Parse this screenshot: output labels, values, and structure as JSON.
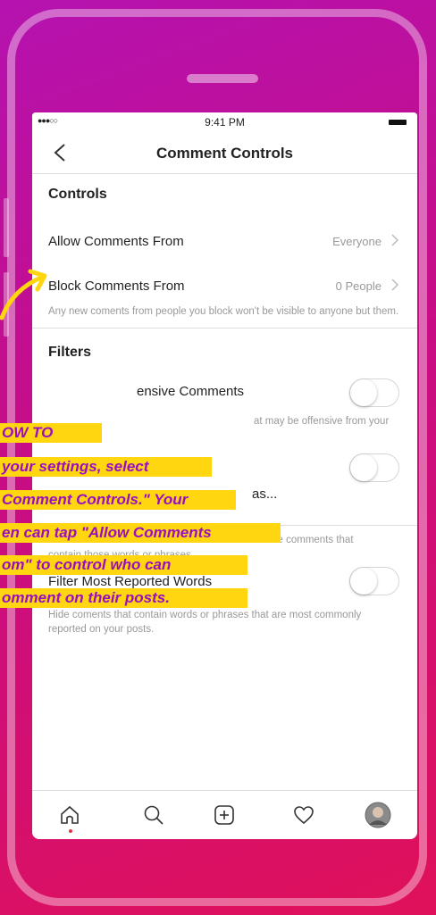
{
  "status_bar": {
    "time": "9:41 PM",
    "signal": "●●●○○"
  },
  "nav": {
    "title": "Comment Controls"
  },
  "controls": {
    "heading": "Controls",
    "allow_label": "Allow Comments From",
    "allow_value": "Everyone",
    "block_label": "Block Comments From",
    "block_value": "0 People",
    "block_desc": "Any new coments from people you block won't be visible to anyone but them."
  },
  "filters": {
    "heading": "Filters",
    "offensive_label_visible": "ensive Comments",
    "offensive_desc_visible": "at may be offensive from your",
    "manual_label_visible": "as...",
    "manual_desc_visible": "will hide comments that",
    "manual_desc_line2": "contain those words or phrases.",
    "reported_label": "Filter Most Reported Words",
    "reported_desc": "Hide coments that contain words or phrases that are most commonly reported on your posts.",
    "offensive_toggle_on": false,
    "manual_toggle_on": false,
    "reported_toggle_on": false
  },
  "overlay": {
    "lines": [
      "OW TO",
      "your settings, select",
      "Comment Controls.\" Your",
      "en can tap \"Allow Comments",
      "om\" to control who can",
      "omment on their posts."
    ],
    "highlight_color": "#ffd60f",
    "text_color": "#9a0dc3"
  },
  "tab_bar": {
    "icons": [
      "home-icon",
      "search-icon",
      "add-post-icon",
      "activity-heart-icon",
      "profile-avatar"
    ]
  },
  "colors": {
    "background_start": "#b512b0",
    "background_end": "#e0115a",
    "accent_red": "#e2313f"
  }
}
